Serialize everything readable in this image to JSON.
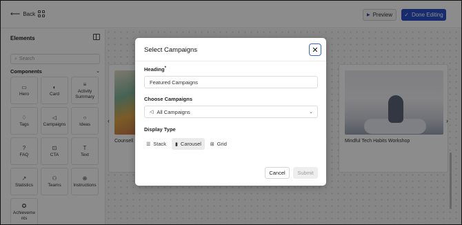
{
  "topbar": {
    "back_label": "Back",
    "preview_label": "Preview",
    "done_label": "Done Editing",
    "accent": "#2950c8"
  },
  "panel": {
    "title": "Elements",
    "search_placeholder": "Search",
    "section_label": "Components",
    "tiles": [
      {
        "label": "Hero",
        "icon": "hero-icon"
      },
      {
        "label": "Card",
        "icon": "card-icon"
      },
      {
        "label": "Activity Summary",
        "icon": "activity-icon"
      },
      {
        "label": "Tags",
        "icon": "tag-icon"
      },
      {
        "label": "Campaigns",
        "icon": "megaphone-icon"
      },
      {
        "label": "Ideas",
        "icon": "lightbulb-icon"
      },
      {
        "label": "FAQ",
        "icon": "question-icon"
      },
      {
        "label": "CTA",
        "icon": "cta-icon"
      },
      {
        "label": "Text",
        "icon": "text-icon"
      },
      {
        "label": "Statistics",
        "icon": "chart-icon"
      },
      {
        "label": "Teams",
        "icon": "users-icon"
      },
      {
        "label": "Instructions",
        "icon": "globe-icon"
      },
      {
        "label": "Achieveme nts",
        "icon": "award-icon"
      }
    ]
  },
  "canvas": {
    "card1_text": "Counsell",
    "card3_text": "Mindful Tech Habits Workshop"
  },
  "modal": {
    "title": "Select Campaigns",
    "heading_label": "Heading",
    "heading_required": "*",
    "heading_value": "Featured Campaigns",
    "choose_label": "Choose Campaigns",
    "choose_value": "All Campaigns",
    "display_label": "Display Type",
    "display_options": [
      {
        "label": "Stack",
        "icon": "list-icon"
      },
      {
        "label": "Carousel",
        "icon": "carousel-icon"
      },
      {
        "label": "Grid",
        "icon": "grid-icon"
      }
    ],
    "display_selected": "Carousel",
    "cancel_label": "Cancel",
    "submit_label": "Submit"
  }
}
